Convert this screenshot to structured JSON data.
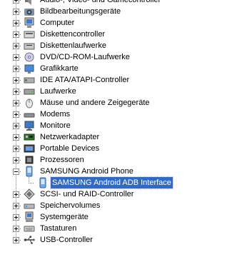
{
  "tree": {
    "items": [
      {
        "label": "Audio-, Video- und Gamecontroller",
        "icon": "speaker-icon",
        "expanded": false
      },
      {
        "label": "Bildbearbeitungsgeräte",
        "icon": "camera-icon",
        "expanded": false
      },
      {
        "label": "Computer",
        "icon": "computer-icon",
        "expanded": false
      },
      {
        "label": "Diskettencontroller",
        "icon": "floppy-controller-icon",
        "expanded": false
      },
      {
        "label": "Diskettenlaufwerke",
        "icon": "floppy-drive-icon",
        "expanded": false
      },
      {
        "label": "DVD/CD-ROM-Laufwerke",
        "icon": "cdrom-icon",
        "expanded": false
      },
      {
        "label": "Grafikkarte",
        "icon": "display-adapter-icon",
        "expanded": false
      },
      {
        "label": "IDE ATA/ATAPI-Controller",
        "icon": "ide-controller-icon",
        "expanded": false
      },
      {
        "label": "Laufwerke",
        "icon": "disk-drive-icon",
        "expanded": false
      },
      {
        "label": "Mäuse und andere Zeigegeräte",
        "icon": "mouse-icon",
        "expanded": false
      },
      {
        "label": "Modems",
        "icon": "modem-icon",
        "expanded": false
      },
      {
        "label": "Monitore",
        "icon": "monitor-icon",
        "expanded": false
      },
      {
        "label": "Netzwerkadapter",
        "icon": "network-adapter-icon",
        "expanded": false
      },
      {
        "label": "Portable Devices",
        "icon": "portable-device-icon",
        "expanded": false
      },
      {
        "label": "Prozessoren",
        "icon": "processor-icon",
        "expanded": false
      },
      {
        "label": "SAMSUNG Android Phone",
        "icon": "phone-device-icon",
        "expanded": true,
        "children": [
          {
            "label": "SAMSUNG Android ADB Interface",
            "icon": "phone-device-icon",
            "selected": true
          }
        ]
      },
      {
        "label": "SCSI- und RAID-Controller",
        "icon": "scsi-controller-icon",
        "expanded": false
      },
      {
        "label": "Speichervolumes",
        "icon": "storage-volume-icon",
        "expanded": false
      },
      {
        "label": "Systemgeräte",
        "icon": "system-device-icon",
        "expanded": false
      },
      {
        "label": "Tastaturen",
        "icon": "keyboard-icon",
        "expanded": false
      },
      {
        "label": "USB-Controller",
        "icon": "usb-icon",
        "expanded": false
      }
    ]
  },
  "colors": {
    "selection": "#316ac5",
    "tree_lines": "#808080"
  }
}
